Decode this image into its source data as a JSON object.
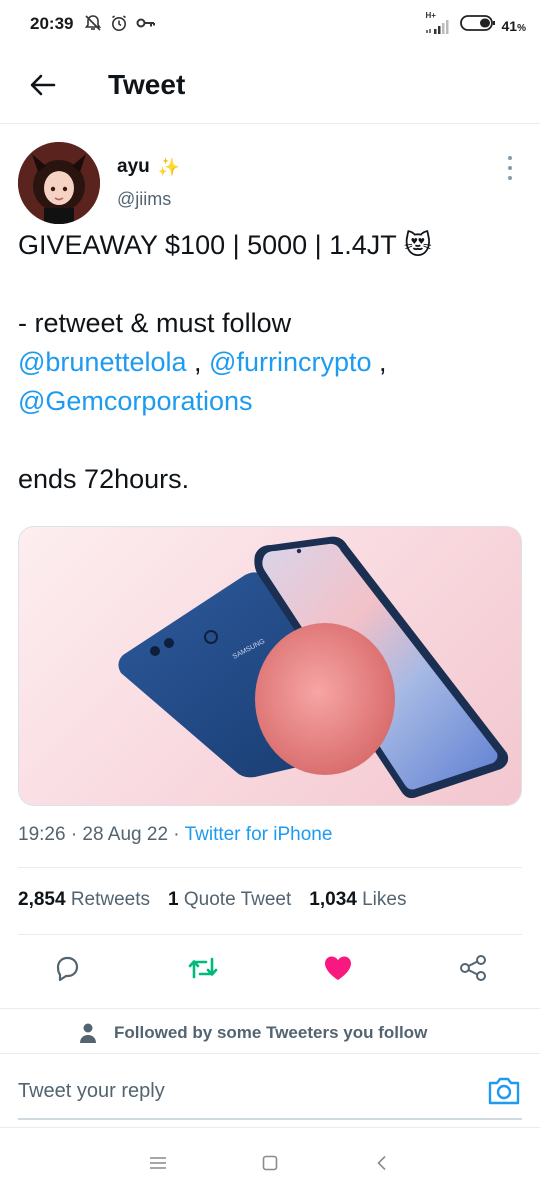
{
  "status_bar": {
    "time": "20:39",
    "network_label": "H+",
    "battery_percent": "41",
    "battery_suffix": "%",
    "icons": [
      "alarm-off-icon",
      "alarm-clock-icon",
      "key-icon",
      "signal-icon",
      "battery-icon"
    ]
  },
  "header": {
    "title": "Tweet",
    "back_icon": "arrow-left-icon"
  },
  "tweet": {
    "author_name": "ayu",
    "author_emoji": "✨",
    "author_handle": "@jiims",
    "text_lines": {
      "line1": "GIVEAWAY $100 | 5000 | 1.4JT 😻",
      "line2": "- retweet & must follow",
      "line3_mention1": "@brunettelola",
      "line3_sep": " , ",
      "line3_mention2": "@furrincrypto",
      "line3_end": " ,",
      "line4_mention": "@Gemcorporations",
      "line5": "ends 72hours."
    },
    "media": {
      "brand": "SAMSUNG"
    },
    "timestamp": "19:26 · 28 Aug 22 · ",
    "source": "Twitter for iPhone",
    "stats": {
      "retweets_count": "2,854",
      "retweets_label": "Retweets",
      "quotes_count": "1",
      "quotes_label": "Quote Tweet",
      "likes_count": "1,034",
      "likes_label": "Likes"
    }
  },
  "actions": {
    "reply_icon": "reply-icon",
    "retweet_icon": "retweet-icon",
    "like_icon": "heart-icon",
    "share_icon": "share-icon",
    "retweet_color": "#00ba7c",
    "like_color": "#f91880"
  },
  "followed_bar": {
    "text": "Followed by some Tweeters you follow"
  },
  "reply": {
    "placeholder": "Tweet your reply"
  },
  "colors": {
    "accent": "#1d9bf0",
    "secondary_text": "#536471"
  }
}
